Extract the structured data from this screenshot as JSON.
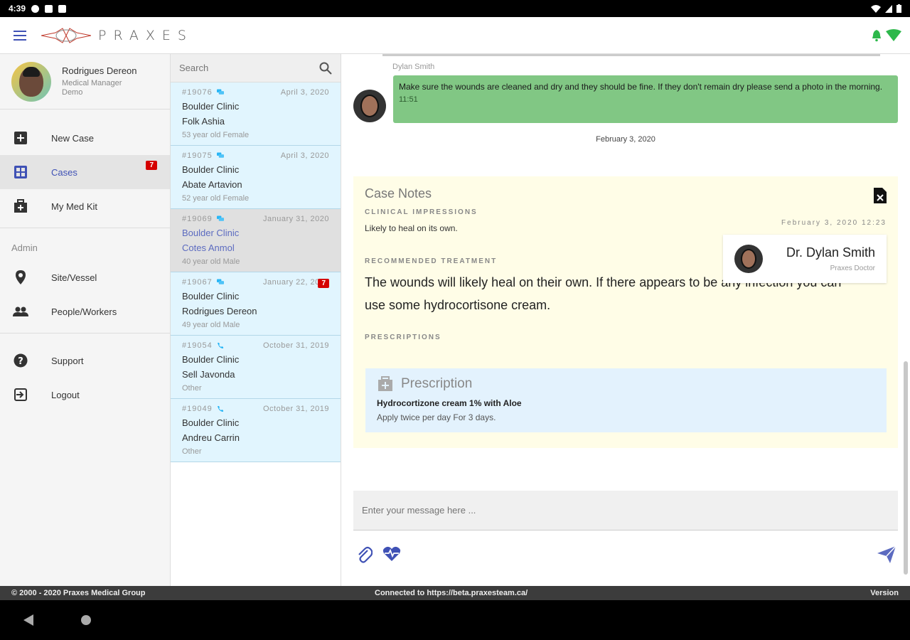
{
  "status_bar": {
    "time": "4:39"
  },
  "app": {
    "logo_text": "PRAXES"
  },
  "colors": {
    "accent": "#3f51b5",
    "bubble": "#81c784",
    "notes_bg": "#fffde7",
    "rx_bg": "#e3f2fd",
    "badge": "#d50000",
    "case_bg": "#e1f5fe"
  },
  "profile": {
    "name": "Rodrigues Dereon",
    "role_line1": "Medical Manager",
    "role_line2": "Demo"
  },
  "sidebar": {
    "new_case": "New Case",
    "cases": "Cases",
    "cases_badge": "7",
    "med_kit": "My Med Kit",
    "admin_label": "Admin",
    "site_vessel": "Site/Vessel",
    "people_workers": "People/Workers",
    "support": "Support",
    "logout": "Logout"
  },
  "search": {
    "placeholder": "Search"
  },
  "cases": [
    {
      "id": "#19076",
      "date": "April 3, 2020",
      "clinic": "Boulder Clinic",
      "name": "Folk Ashia",
      "desc": "53 year old Female",
      "kind": "chat-icon",
      "badge": ""
    },
    {
      "id": "#19075",
      "date": "April 3, 2020",
      "clinic": "Boulder Clinic",
      "name": "Abate Artavion",
      "desc": "52 year old Female",
      "kind": "chat-icon",
      "badge": ""
    },
    {
      "id": "#19069",
      "date": "January 31, 2020",
      "clinic": "Boulder Clinic",
      "name": "Cotes Anmol",
      "desc": "40 year old Male",
      "kind": "chat-icon",
      "badge": ""
    },
    {
      "id": "#19067",
      "date": "January 22, 2020",
      "clinic": "Boulder Clinic",
      "name": "Rodrigues Dereon",
      "desc": "49 year old Male",
      "kind": "chat-icon",
      "badge": "7"
    },
    {
      "id": "#19054",
      "date": "October 31, 2019",
      "clinic": "Boulder Clinic",
      "name": "Sell Javonda",
      "desc": "Other",
      "kind": "phone-icon",
      "badge": ""
    },
    {
      "id": "#19049",
      "date": "October 31, 2019",
      "clinic": "Boulder Clinic",
      "name": "Andreu Carrin",
      "desc": "Other",
      "kind": "phone-icon",
      "badge": ""
    }
  ],
  "chat": {
    "sender": "Dylan Smith",
    "message": "Make sure the wounds are cleaned and dry and they should be fine. If they don't remain dry please send a photo in the morning.",
    "time": "11:51",
    "date_divider": "February 3, 2020"
  },
  "notes": {
    "title": "Case Notes",
    "clinical_label": "CLINICAL IMPRESSIONS",
    "clinical_text": "Likely to heal on its own.",
    "date": "February 3, 2020 12:23",
    "doctor_name": "Dr. Dylan Smith",
    "doctor_role": "Praxes Doctor",
    "treatment_label": "RECOMMENDED TREATMENT",
    "treatment_text": "The wounds will likely heal on their own. If there appears to be any infection you can use some hydrocortisone cream.",
    "prescriptions_label": "PRESCRIPTIONS",
    "rx_title": "Prescription",
    "rx_name": "Hydrocortizone cream 1% with Aloe",
    "rx_directions": "Apply twice per day For 3 days."
  },
  "composer": {
    "placeholder": "Enter your message here ..."
  },
  "footer": {
    "copyright": "© 2000 - 2020 Praxes Medical Group",
    "connection": "Connected to https://beta.praxesteam.ca/",
    "version": "Version"
  }
}
